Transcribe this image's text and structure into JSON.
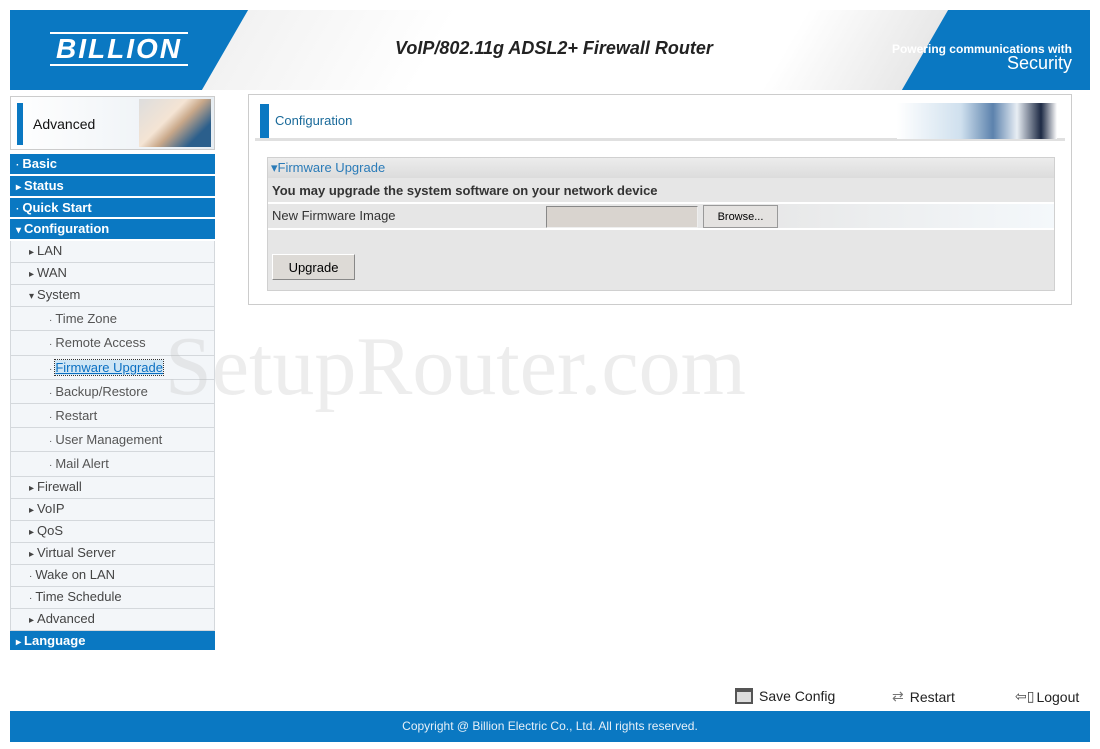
{
  "header": {
    "logo": "BILLION",
    "title": "VoIP/802.11g ADSL2+ Firewall Router",
    "tagline_small": "Powering communications with",
    "tagline_big": "Security"
  },
  "mode_label": "Advanced",
  "sidebar": {
    "items": [
      {
        "label": "Basic",
        "level": "top",
        "arrow": "·"
      },
      {
        "label": "Status",
        "level": "top",
        "arrow": "▸"
      },
      {
        "label": "Quick Start",
        "level": "top",
        "arrow": "·"
      },
      {
        "label": "Configuration",
        "level": "top",
        "arrow": "▾"
      },
      {
        "label": "LAN",
        "level": "sub",
        "arrow": "▸"
      },
      {
        "label": "WAN",
        "level": "sub",
        "arrow": "▸"
      },
      {
        "label": "System",
        "level": "sub",
        "arrow": "▾"
      },
      {
        "label": "Time Zone",
        "level": "sub2",
        "arrow": "·"
      },
      {
        "label": "Remote Access",
        "level": "sub2",
        "arrow": "·"
      },
      {
        "label": "Firmware Upgrade",
        "level": "sub2",
        "arrow": "·",
        "active": true
      },
      {
        "label": "Backup/Restore",
        "level": "sub2",
        "arrow": "·"
      },
      {
        "label": "Restart",
        "level": "sub2",
        "arrow": "·"
      },
      {
        "label": "User Management",
        "level": "sub2",
        "arrow": "·"
      },
      {
        "label": "Mail Alert",
        "level": "sub2",
        "arrow": "·"
      },
      {
        "label": "Firewall",
        "level": "sub",
        "arrow": "▸"
      },
      {
        "label": "VoIP",
        "level": "sub",
        "arrow": "▸"
      },
      {
        "label": "QoS",
        "level": "sub",
        "arrow": "▸"
      },
      {
        "label": "Virtual Server",
        "level": "sub",
        "arrow": "▸"
      },
      {
        "label": "Wake on LAN",
        "level": "sub",
        "arrow": "·"
      },
      {
        "label": "Time Schedule",
        "level": "sub",
        "arrow": "·"
      },
      {
        "label": "Advanced",
        "level": "sub",
        "arrow": "▸"
      },
      {
        "label": "Language",
        "level": "top",
        "arrow": "▸"
      }
    ]
  },
  "main": {
    "section_title": "Configuration",
    "firmware": {
      "title": "▾Firmware Upgrade",
      "description": "You may upgrade the system software on your network device",
      "field_label": "New Firmware Image",
      "file_value": "",
      "browse_label": "Browse...",
      "upgrade_label": "Upgrade"
    }
  },
  "watermark": "SetupRouter.com",
  "actions": {
    "save": "Save Config",
    "restart": "Restart",
    "logout": "Logout"
  },
  "footer": "Copyright @ Billion Electric Co., Ltd. All rights reserved.",
  "colors": {
    "brand_blue": "#0a78c2"
  }
}
